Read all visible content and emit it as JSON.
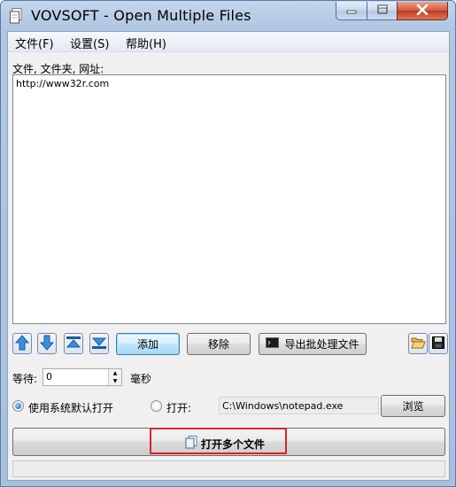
{
  "window": {
    "title": "VOVSOFT - Open Multiple Files",
    "app_icon": "files-icon"
  },
  "title_buttons": {
    "minimize": "minimize-icon",
    "maximize": "maximize-icon",
    "close": "close-icon"
  },
  "menu": {
    "file": "文件(F)",
    "settings": "设置(S)",
    "help": "帮助(H)"
  },
  "list": {
    "label": "文件, 文件夹, 网址:",
    "items": [
      "http://www32r.com"
    ]
  },
  "toolbar": {
    "move_up": "arrow-up-icon",
    "move_down": "arrow-down-icon",
    "move_top": "move-top-icon",
    "move_bottom": "move-bottom-icon",
    "add": "添加",
    "remove": "移除",
    "export": "导出批处理文件",
    "export_icon": "terminal-icon",
    "open_list": "folder-open-icon",
    "save_list": "save-icon"
  },
  "wait": {
    "label": "等待:",
    "value": "0",
    "unit": "毫秒"
  },
  "open_with": {
    "default_label": "使用系统默认打开",
    "default_selected": true,
    "custom_label": "打开:",
    "custom_path": "C:\\Windows\\notepad.exe",
    "browse": "浏览"
  },
  "main_action": {
    "label": "打开多个文件",
    "icon": "files-icon"
  },
  "colors": {
    "highlight": "#e02424",
    "arrow_blue": "#2f7fd0",
    "title_bar": "#b1c7e2"
  }
}
